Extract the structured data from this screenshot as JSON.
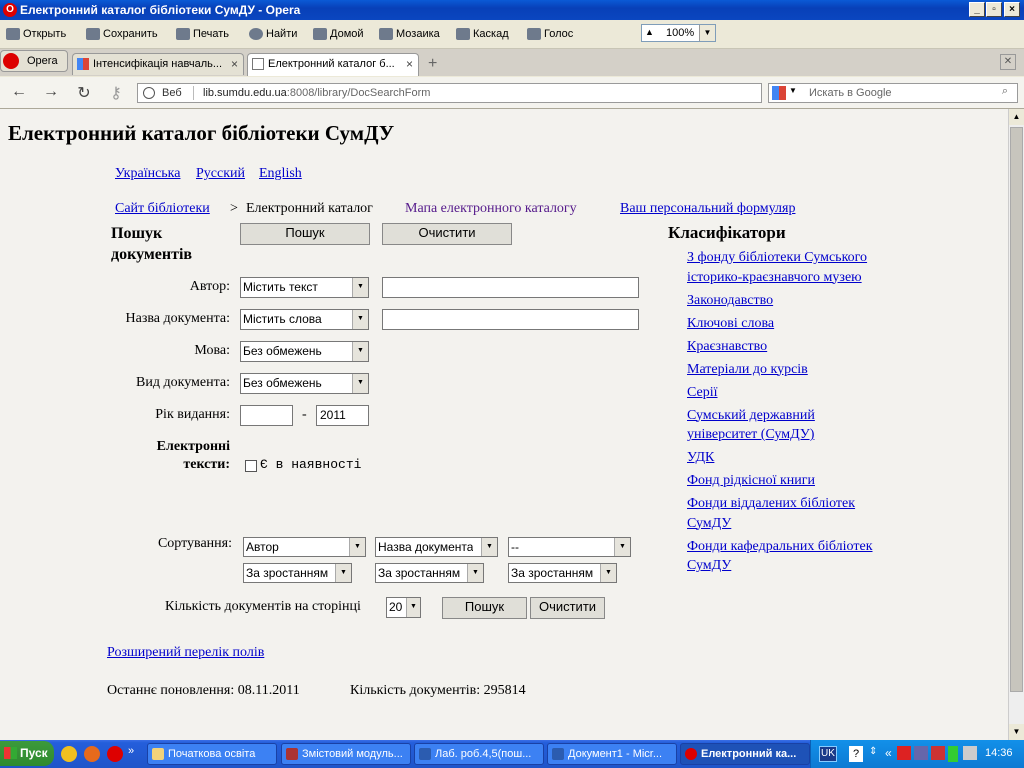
{
  "window": {
    "title": "Електронний каталог бібліотеки СумДУ - Opera"
  },
  "toolbar": {
    "open": "Открыть",
    "save": "Сохранить",
    "print": "Печать",
    "find": "Найти",
    "home": "Домой",
    "mosaic": "Мозаика",
    "cascade": "Каскад",
    "voice": "Голос",
    "zoom": "100%"
  },
  "tabs": {
    "menu": "Opera",
    "items": [
      {
        "label": "Інтенсифікація навчаль..."
      },
      {
        "label": "Електронний каталог б..."
      }
    ]
  },
  "address": {
    "mode": "Веб",
    "host": "lib.sumdu.edu.ua",
    "rest": ":8008/library/DocSearchForm",
    "search_placeholder": "Искать в Google"
  },
  "page": {
    "title": "Електронний каталог бібліотеки СумДУ",
    "langs": [
      "Українська",
      "Русский",
      "English"
    ],
    "nav": {
      "site": "Сайт бібліотеки",
      "sep": ">",
      "current": "Електронний каталог",
      "map": "Мапа електронного каталогу",
      "personal": "Ваш персональний формуляр"
    },
    "search_heading_1": "Пошук",
    "search_heading_2": "документів",
    "search_button": "Пошук",
    "clear_button": "Очистити",
    "fields": {
      "author_label": "Автор:",
      "author_mode": "Містить текст",
      "title_label": "Назва документа:",
      "title_mode": "Містить слова",
      "lang_label": "Мова:",
      "lang_value": "Без обмежень",
      "type_label": "Вид документа:",
      "type_value": "Без обмежень",
      "year_label": "Рік видання:",
      "year_sep": "-",
      "year_to": "2011",
      "etext_label_1": "Електронні",
      "etext_label_2": "тексти:",
      "etext_option": "Є в наявності"
    },
    "sort": {
      "label": "Сортування:",
      "fields": [
        "Автор",
        "Назва документа",
        "--"
      ],
      "orders": [
        "За зростанням",
        "За зростанням",
        "За зростанням"
      ]
    },
    "per_page_label": "Кількість документів на сторінці",
    "per_page_value": "20",
    "extended_link": "Розширений перелік полів",
    "footer": {
      "updated": "Останнє поновлення: 08.11.2011",
      "count": "Кількість документів: 295814"
    },
    "classifiers": {
      "heading": "Класифікатори",
      "items": [
        [
          "З фонду бібліотеки Сумського",
          "історико-краєзнавчого музею"
        ],
        [
          "Законодавство"
        ],
        [
          "Ключові слова"
        ],
        [
          "Краєзнавство"
        ],
        [
          "Матеріали до курсів"
        ],
        [
          "Серії"
        ],
        [
          "Сумський державний",
          "університет (СумДУ)"
        ],
        [
          "УДК"
        ],
        [
          "Фонд рідкісної книги"
        ],
        [
          "Фонди віддалених бібліотек",
          "СумДУ"
        ],
        [
          "Фонди кафедральних бібліотек",
          "СумДУ"
        ]
      ]
    }
  },
  "taskbar": {
    "start": "Пуск",
    "buttons": [
      "Початкова освіта",
      "Змістовий модуль...",
      "Лаб. роб.4,5(пош...",
      "Документ1 - Micr...",
      "Електронний ка..."
    ],
    "lang": "UK",
    "time": "14:36"
  }
}
